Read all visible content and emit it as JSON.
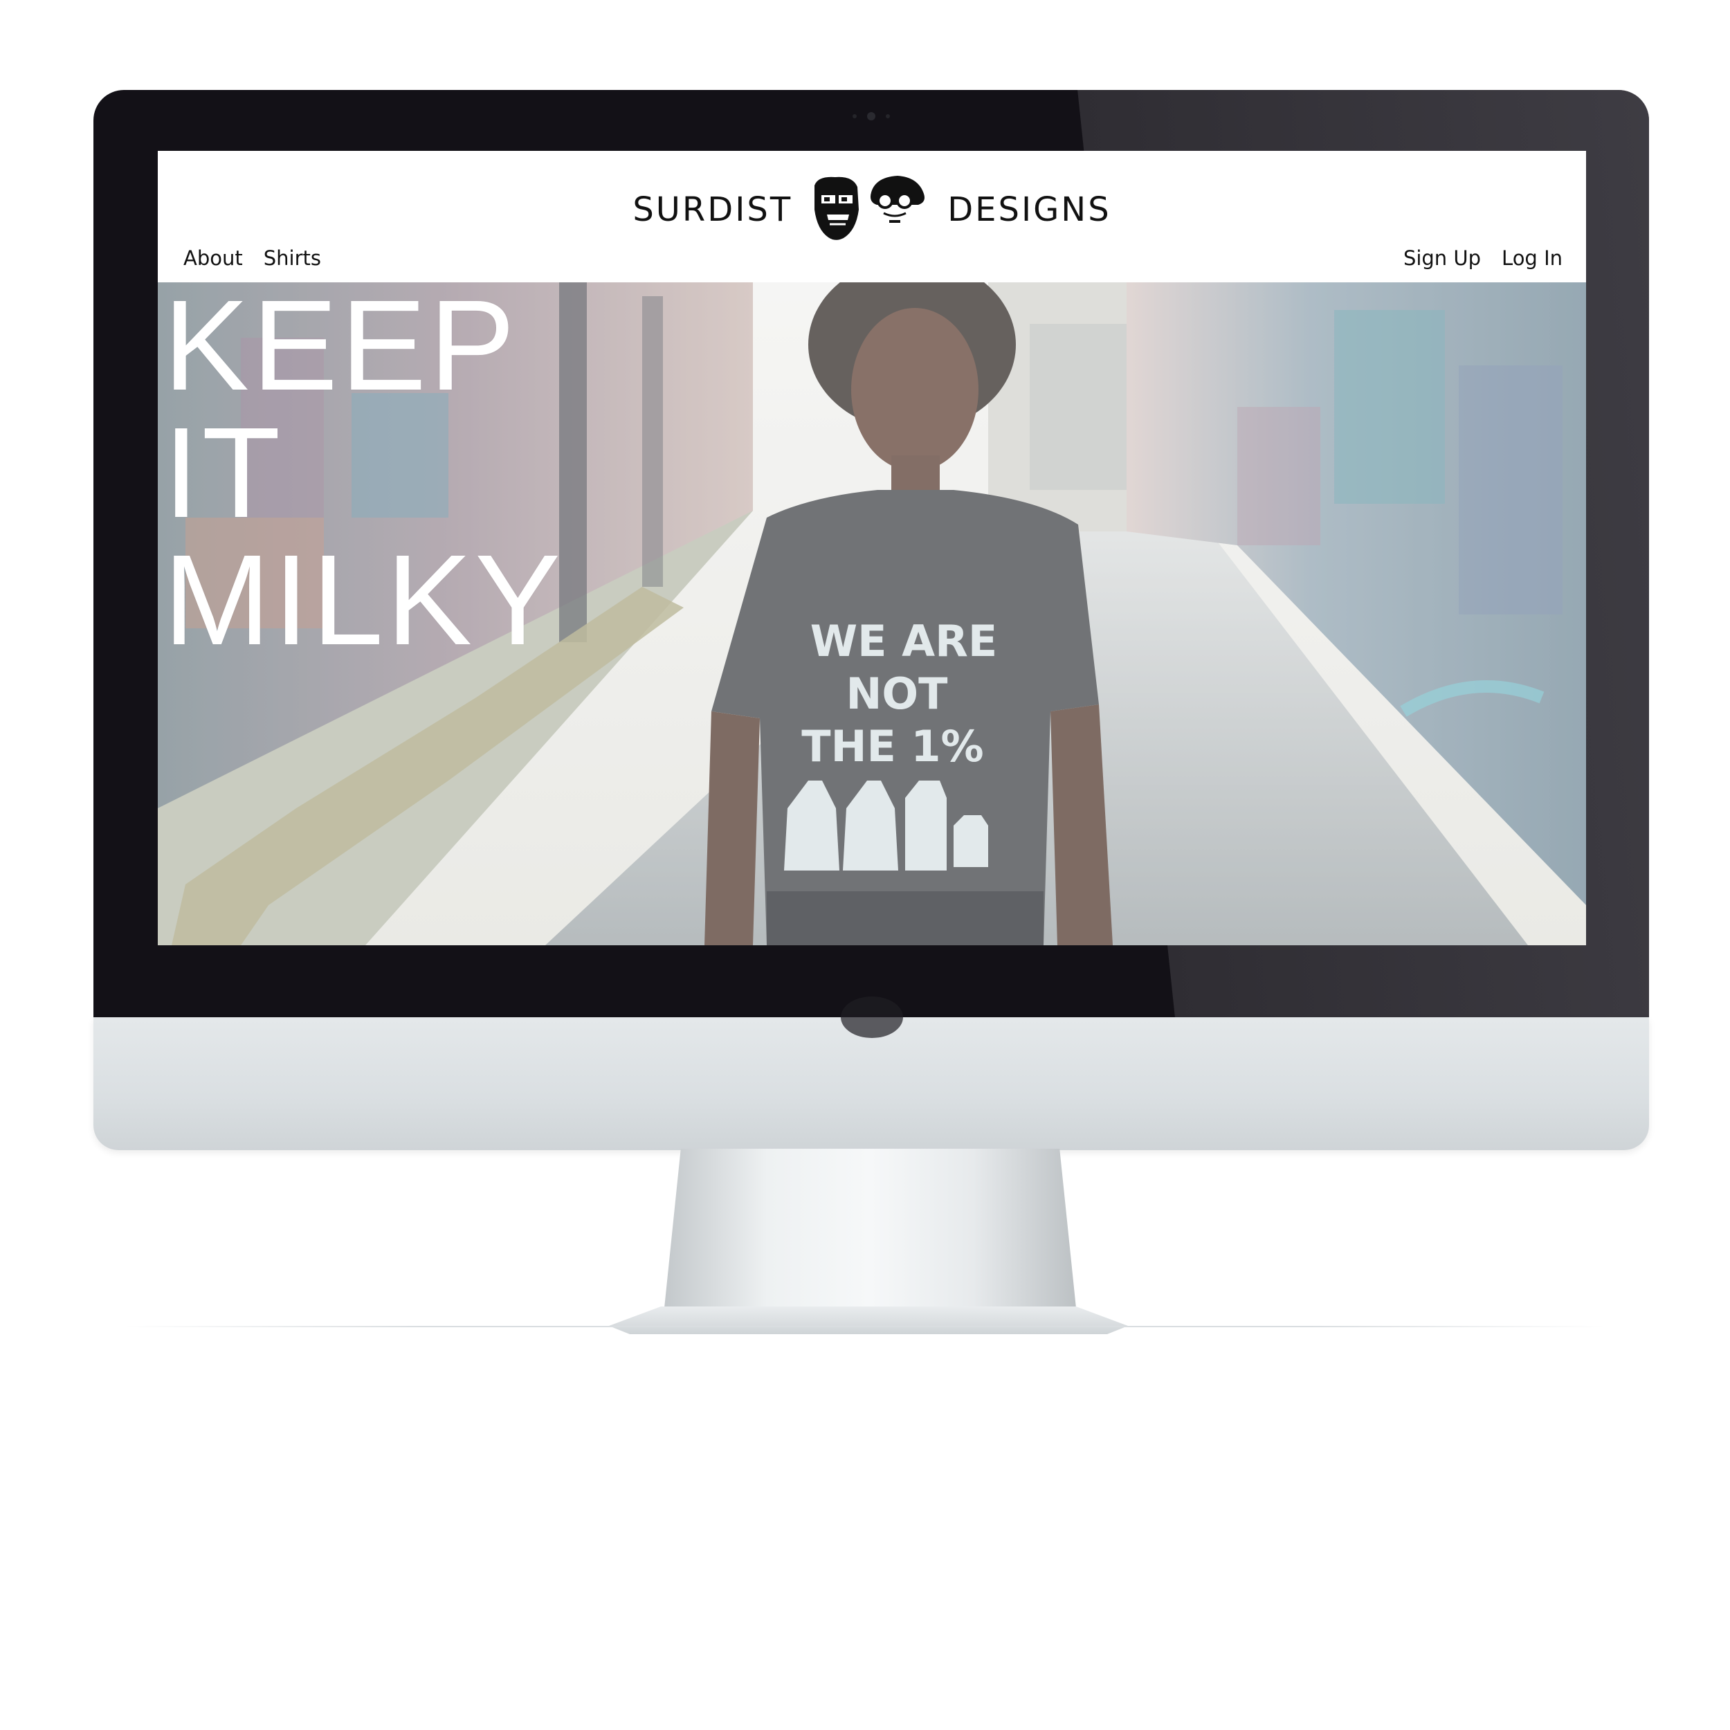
{
  "site": {
    "brand_left": "SURDIST",
    "brand_right": "DESIGNS",
    "logo_icon": "two-faces-logo"
  },
  "nav": {
    "left": [
      {
        "label": "About"
      },
      {
        "label": "Shirts"
      }
    ],
    "right": [
      {
        "label": "Sign Up"
      },
      {
        "label": "Log In"
      }
    ]
  },
  "hero": {
    "headline_lines": [
      "KEEP",
      "IT",
      "MILKY"
    ],
    "shirt_text_lines": [
      "WE ARE",
      "NOT",
      "THE 1%"
    ],
    "shirt_icons": [
      "milk-jug-icon",
      "milk-jug-icon",
      "milk-carton-icon",
      "milk-carton-small-icon"
    ]
  },
  "colors": {
    "header_bg": "#ffffff",
    "text": "#111111",
    "headline": "#ffffff",
    "bezel": "#131117"
  }
}
